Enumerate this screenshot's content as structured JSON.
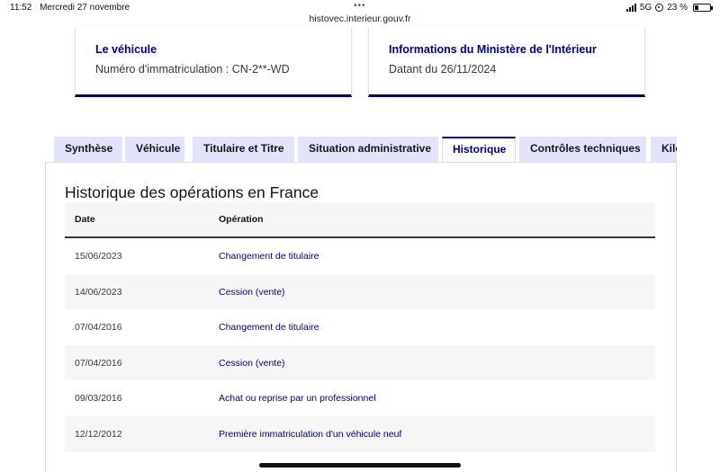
{
  "status_bar": {
    "time": "11:52",
    "date": "Mercredi 27 novembre",
    "url": "histovec.interieur.gouv.fr",
    "network": "5G",
    "battery": "23 %",
    "battery_level": 0.23
  },
  "cards": {
    "vehicule": {
      "title": "Le véhicule",
      "text": "Numéro d'immatriculation : CN-2**-WD"
    },
    "ministere": {
      "title": "Informations du Ministère de l'Intérieur",
      "text": "Datant du 26/11/2024"
    }
  },
  "tabs": [
    {
      "label": "Synthèse",
      "active": false
    },
    {
      "label": "Véhicule",
      "active": false
    },
    {
      "label": "Titulaire et Titre",
      "active": false
    },
    {
      "label": "Situation administrative",
      "active": false
    },
    {
      "label": "Historique",
      "active": true
    },
    {
      "label": "Contrôles techniques",
      "active": false
    },
    {
      "label": "Kilométrage",
      "active": false
    }
  ],
  "historique": {
    "title": "Historique des opérations en France",
    "columns": {
      "date": "Date",
      "operation": "Opération"
    },
    "rows": [
      {
        "date": "15/06/2023",
        "operation": "Changement de titulaire"
      },
      {
        "date": "14/06/2023",
        "operation": "Cession (vente)"
      },
      {
        "date": "07/04/2016",
        "operation": "Changement de titulaire"
      },
      {
        "date": "07/04/2016",
        "operation": "Cession (vente)"
      },
      {
        "date": "09/03/2016",
        "operation": "Achat ou reprise par un professionnel"
      },
      {
        "date": "12/12/2012",
        "operation": "Première immatriculation d'un véhicule neuf"
      }
    ]
  },
  "colors": {
    "primary": "#000091",
    "tab_bg": "#e3e3fd",
    "row_alt": "#f6f6f6"
  }
}
